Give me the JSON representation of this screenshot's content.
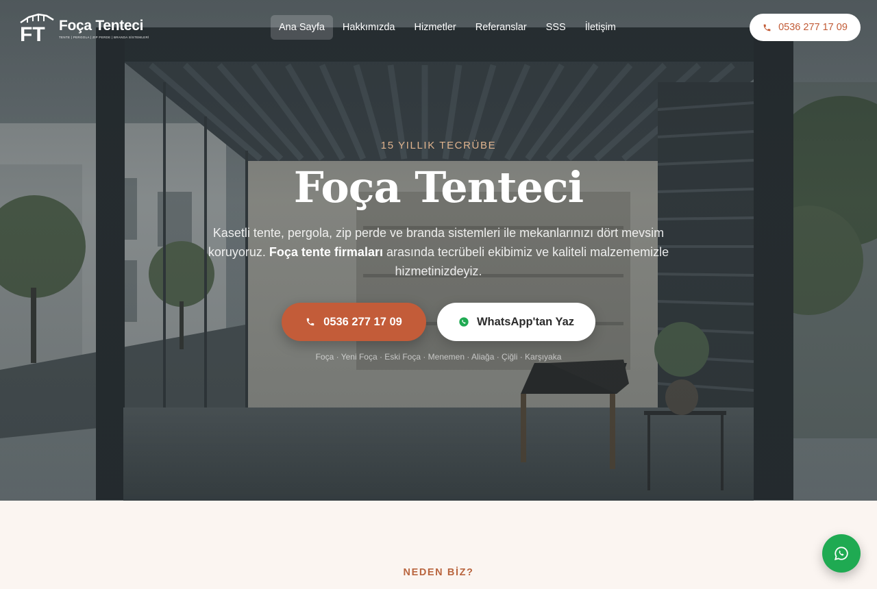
{
  "brand": {
    "name": "Foça Tenteci",
    "tagline": "TENTE | PERGOLA | ZIP PERDE | BRANDA SİSTEMLERİ",
    "monogram": "FT"
  },
  "nav": {
    "items": [
      {
        "label": "Ana Sayfa",
        "active": true
      },
      {
        "label": "Hakkımızda",
        "active": false
      },
      {
        "label": "Hizmetler",
        "active": false
      },
      {
        "label": "Referanslar",
        "active": false
      },
      {
        "label": "SSS",
        "active": false
      },
      {
        "label": "İletişim",
        "active": false
      }
    ],
    "phone": "0536 277 17 09"
  },
  "hero": {
    "eyebrow": "15 YILLIK TECRÜBE",
    "title": "Foça Tenteci",
    "desc_part1": "Kasetli tente, pergola, zip perde ve branda sistemleri ile mekanlarınızı dört mevsim koruyoruz.",
    "desc_bold": "Foça tente firmaları",
    "desc_part2": "arasında tecrübeli ekibimiz ve kaliteli malzememizle hizmetinizdeyiz.",
    "call_label": "0536 277 17 09",
    "whatsapp_label": "WhatsApp'tan Yaz",
    "regions": "Foça · Yeni Foça · Eski Foça · Menemen · Aliağa · Çiğli · Karşıyaka"
  },
  "section": {
    "label": "NEDEN BİZ?"
  },
  "icons": {
    "phone": "phone-icon",
    "whatsapp": "whatsapp-icon"
  },
  "colors": {
    "accent": "#c35c39",
    "whatsapp": "#1faa52",
    "eyebrow": "#e0b48e",
    "section_bg": "#fbf5f1"
  }
}
